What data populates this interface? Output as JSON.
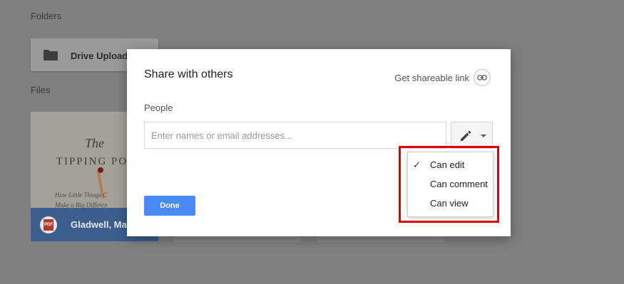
{
  "background": {
    "folders_heading": "Folders",
    "files_heading": "Files",
    "folder": {
      "name": "Drive Upload",
      "icon": "folder-icon"
    },
    "file": {
      "name": "Gladwell, Mal",
      "type_badge": "PDF",
      "thumbnail": {
        "title_line1": "The",
        "title_line2": "TIPPING POI",
        "subtitle_line1": "How Little Things C",
        "subtitle_line2": "Make a Big Differen"
      }
    }
  },
  "dialog": {
    "title": "Share with others",
    "shareable_link_label": "Get shareable link",
    "shareable_link_icon": "link-icon",
    "people_label": "People",
    "people_input": {
      "value": "",
      "placeholder": "Enter names or email addresses..."
    },
    "permission_button_icon": "pencil-icon",
    "done_label": "Done"
  },
  "permission_menu": {
    "items": [
      {
        "label": "Can edit",
        "checked": true
      },
      {
        "label": "Can comment",
        "checked": false
      },
      {
        "label": "Can view",
        "checked": false
      }
    ],
    "check_mark": "✓"
  },
  "colors": {
    "accent": "#4a8af4",
    "highlight": "#e00000",
    "overlay": "#808080"
  }
}
